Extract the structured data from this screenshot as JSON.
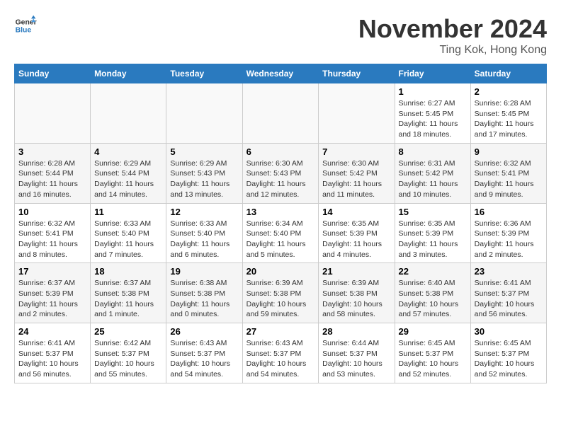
{
  "header": {
    "logo_line1": "General",
    "logo_line2": "Blue",
    "month": "November 2024",
    "location": "Ting Kok, Hong Kong"
  },
  "days_of_week": [
    "Sunday",
    "Monday",
    "Tuesday",
    "Wednesday",
    "Thursday",
    "Friday",
    "Saturday"
  ],
  "weeks": [
    [
      {
        "day": "",
        "info": ""
      },
      {
        "day": "",
        "info": ""
      },
      {
        "day": "",
        "info": ""
      },
      {
        "day": "",
        "info": ""
      },
      {
        "day": "",
        "info": ""
      },
      {
        "day": "1",
        "info": "Sunrise: 6:27 AM\nSunset: 5:45 PM\nDaylight: 11 hours and 18 minutes."
      },
      {
        "day": "2",
        "info": "Sunrise: 6:28 AM\nSunset: 5:45 PM\nDaylight: 11 hours and 17 minutes."
      }
    ],
    [
      {
        "day": "3",
        "info": "Sunrise: 6:28 AM\nSunset: 5:44 PM\nDaylight: 11 hours and 16 minutes."
      },
      {
        "day": "4",
        "info": "Sunrise: 6:29 AM\nSunset: 5:44 PM\nDaylight: 11 hours and 14 minutes."
      },
      {
        "day": "5",
        "info": "Sunrise: 6:29 AM\nSunset: 5:43 PM\nDaylight: 11 hours and 13 minutes."
      },
      {
        "day": "6",
        "info": "Sunrise: 6:30 AM\nSunset: 5:43 PM\nDaylight: 11 hours and 12 minutes."
      },
      {
        "day": "7",
        "info": "Sunrise: 6:30 AM\nSunset: 5:42 PM\nDaylight: 11 hours and 11 minutes."
      },
      {
        "day": "8",
        "info": "Sunrise: 6:31 AM\nSunset: 5:42 PM\nDaylight: 11 hours and 10 minutes."
      },
      {
        "day": "9",
        "info": "Sunrise: 6:32 AM\nSunset: 5:41 PM\nDaylight: 11 hours and 9 minutes."
      }
    ],
    [
      {
        "day": "10",
        "info": "Sunrise: 6:32 AM\nSunset: 5:41 PM\nDaylight: 11 hours and 8 minutes."
      },
      {
        "day": "11",
        "info": "Sunrise: 6:33 AM\nSunset: 5:40 PM\nDaylight: 11 hours and 7 minutes."
      },
      {
        "day": "12",
        "info": "Sunrise: 6:33 AM\nSunset: 5:40 PM\nDaylight: 11 hours and 6 minutes."
      },
      {
        "day": "13",
        "info": "Sunrise: 6:34 AM\nSunset: 5:40 PM\nDaylight: 11 hours and 5 minutes."
      },
      {
        "day": "14",
        "info": "Sunrise: 6:35 AM\nSunset: 5:39 PM\nDaylight: 11 hours and 4 minutes."
      },
      {
        "day": "15",
        "info": "Sunrise: 6:35 AM\nSunset: 5:39 PM\nDaylight: 11 hours and 3 minutes."
      },
      {
        "day": "16",
        "info": "Sunrise: 6:36 AM\nSunset: 5:39 PM\nDaylight: 11 hours and 2 minutes."
      }
    ],
    [
      {
        "day": "17",
        "info": "Sunrise: 6:37 AM\nSunset: 5:39 PM\nDaylight: 11 hours and 2 minutes."
      },
      {
        "day": "18",
        "info": "Sunrise: 6:37 AM\nSunset: 5:38 PM\nDaylight: 11 hours and 1 minute."
      },
      {
        "day": "19",
        "info": "Sunrise: 6:38 AM\nSunset: 5:38 PM\nDaylight: 11 hours and 0 minutes."
      },
      {
        "day": "20",
        "info": "Sunrise: 6:39 AM\nSunset: 5:38 PM\nDaylight: 10 hours and 59 minutes."
      },
      {
        "day": "21",
        "info": "Sunrise: 6:39 AM\nSunset: 5:38 PM\nDaylight: 10 hours and 58 minutes."
      },
      {
        "day": "22",
        "info": "Sunrise: 6:40 AM\nSunset: 5:38 PM\nDaylight: 10 hours and 57 minutes."
      },
      {
        "day": "23",
        "info": "Sunrise: 6:41 AM\nSunset: 5:37 PM\nDaylight: 10 hours and 56 minutes."
      }
    ],
    [
      {
        "day": "24",
        "info": "Sunrise: 6:41 AM\nSunset: 5:37 PM\nDaylight: 10 hours and 56 minutes."
      },
      {
        "day": "25",
        "info": "Sunrise: 6:42 AM\nSunset: 5:37 PM\nDaylight: 10 hours and 55 minutes."
      },
      {
        "day": "26",
        "info": "Sunrise: 6:43 AM\nSunset: 5:37 PM\nDaylight: 10 hours and 54 minutes."
      },
      {
        "day": "27",
        "info": "Sunrise: 6:43 AM\nSunset: 5:37 PM\nDaylight: 10 hours and 54 minutes."
      },
      {
        "day": "28",
        "info": "Sunrise: 6:44 AM\nSunset: 5:37 PM\nDaylight: 10 hours and 53 minutes."
      },
      {
        "day": "29",
        "info": "Sunrise: 6:45 AM\nSunset: 5:37 PM\nDaylight: 10 hours and 52 minutes."
      },
      {
        "day": "30",
        "info": "Sunrise: 6:45 AM\nSunset: 5:37 PM\nDaylight: 10 hours and 52 minutes."
      }
    ]
  ]
}
